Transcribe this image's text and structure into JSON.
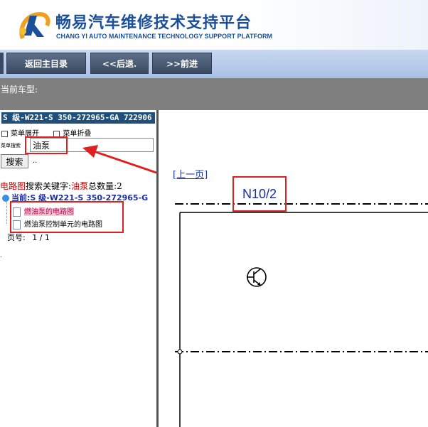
{
  "header": {
    "title": "畅易汽车维修技术支持平台",
    "subtitle": "CHANG YI AUTO MAINTENANCE TECHNOLOGY SUPPORT PLATFORM"
  },
  "toolbar": {
    "home_label": "返回主目录",
    "back_label": "<<后退.",
    "forward_label": ">>前进"
  },
  "car": {
    "label": "当前车型:"
  },
  "sidebar": {
    "model_title": "S 级-W221-S 350-272965-GA 722906",
    "expand_label": "菜单展开",
    "collapse_label": "菜单折叠",
    "search_label": "菜单搜索",
    "search_value": "油泵",
    "search_button": "搜索",
    "search_dots": "..",
    "result_prefix": "电路图",
    "result_mid": "搜索关键字:",
    "result_keyword": "油泵",
    "result_count_label": "总数量:",
    "result_count": "2",
    "tree_root": "当前:S 级-W221-S 350-272965-G",
    "items": [
      {
        "label": "燃油泵的电路图"
      },
      {
        "label": "燃油泵控制单元的电路图"
      }
    ],
    "page_label": "页号:",
    "page_value": "1 / 1",
    "dot": "."
  },
  "main": {
    "prev_link": "[上一页]",
    "diagram_label": "N10/2"
  },
  "colors": {
    "brand_blue": "#1a4f9c",
    "toolbar_button": "#3b4a61",
    "car_bar": "#7f7f7f",
    "annotation_red": "#e02020",
    "highlight": "#f8c8d8"
  }
}
